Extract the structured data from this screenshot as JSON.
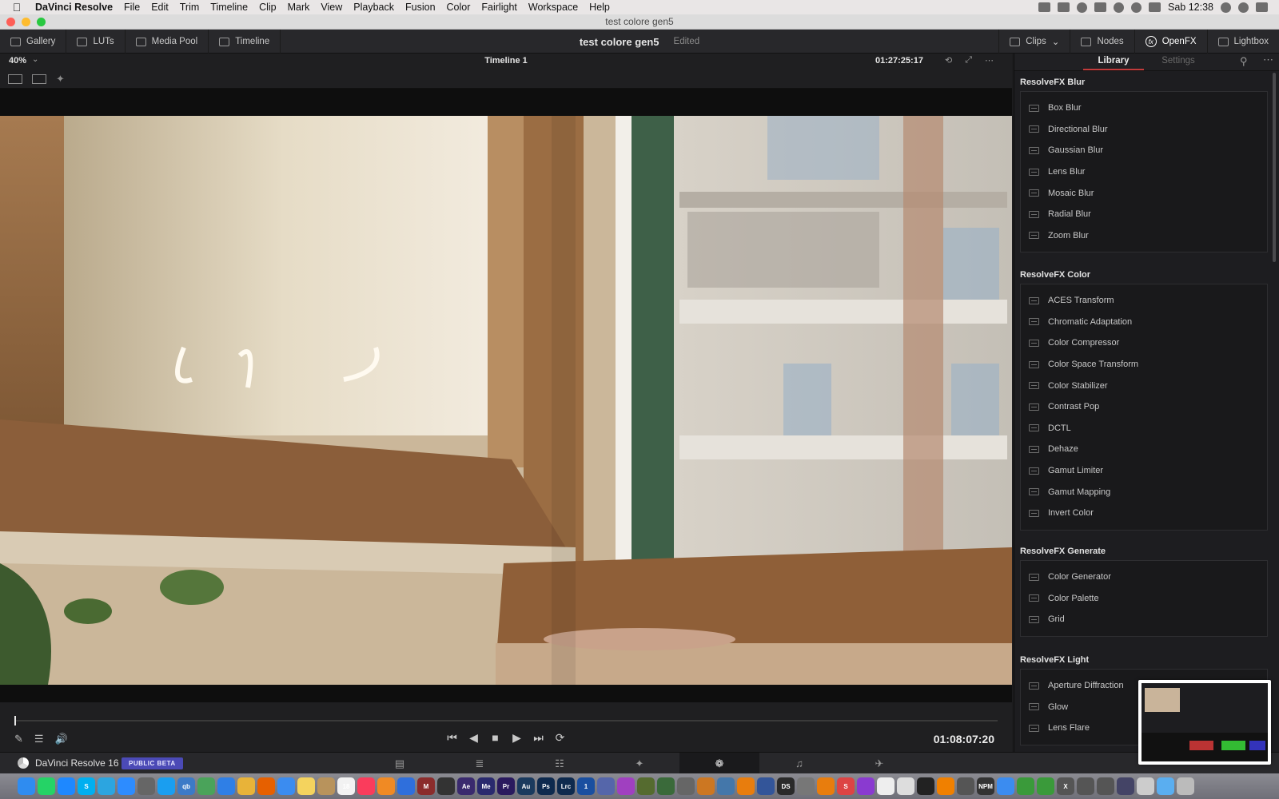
{
  "menubar": {
    "apple_icon": "apple-logo-icon",
    "app_name": "DaVinci Resolve",
    "items": [
      "File",
      "Edit",
      "Trim",
      "Timeline",
      "Clip",
      "Mark",
      "View",
      "Playback",
      "Fusion",
      "Color",
      "Fairlight",
      "Workspace",
      "Help"
    ],
    "clock": "Sab 12:38"
  },
  "window": {
    "title": "test colore gen5"
  },
  "toolbar": {
    "left_buttons": [
      "Gallery",
      "LUTs",
      "Media Pool",
      "Timeline"
    ],
    "project_name": "test colore gen5",
    "status": "Edited",
    "right_buttons": [
      "Clips",
      "Nodes",
      "OpenFX",
      "Lightbox"
    ],
    "active_button": "OpenFX"
  },
  "viewer": {
    "zoom": "40%",
    "timeline_name": "Timeline 1",
    "timecode_top": "01:27:25:17",
    "timecode_bottom": "01:08:07:20"
  },
  "panel": {
    "tabs": {
      "library": "Library",
      "settings": "Settings"
    },
    "active_tab": "Library",
    "accent_color": "#c23b3b",
    "categories": [
      {
        "title": "ResolveFX Blur",
        "items": [
          "Box Blur",
          "Directional Blur",
          "Gaussian Blur",
          "Lens Blur",
          "Mosaic Blur",
          "Radial Blur",
          "Zoom Blur"
        ]
      },
      {
        "title": "ResolveFX Color",
        "items": [
          "ACES Transform",
          "Chromatic Adaptation",
          "Color Compressor",
          "Color Space Transform",
          "Color Stabilizer",
          "Contrast Pop",
          "DCTL",
          "Dehaze",
          "Gamut Limiter",
          "Gamut Mapping",
          "Invert Color"
        ]
      },
      {
        "title": "ResolveFX Generate",
        "items": [
          "Color Generator",
          "Color Palette",
          "Grid"
        ]
      },
      {
        "title": "ResolveFX Light",
        "items": [
          "Aperture Diffraction",
          "Glow",
          "Lens Flare"
        ]
      }
    ]
  },
  "pagebar": {
    "app_label": "DaVinci Resolve 16",
    "badge": "PUBLIC BETA",
    "badge_color": "#4b4ab6",
    "pages": [
      "media-page-icon",
      "cut-page-icon",
      "edit-page-icon",
      "fusion-page-icon",
      "color-page-icon",
      "fairlight-page-icon",
      "deliver-page-icon"
    ],
    "active_page": "color-page-icon"
  },
  "dock": {
    "apps": [
      {
        "name": "finder-icon",
        "label": "",
        "color": "#2f8cf0"
      },
      {
        "name": "whatsapp-icon",
        "label": "",
        "color": "#25d366"
      },
      {
        "name": "messenger-icon",
        "label": "",
        "color": "#1e88ff"
      },
      {
        "name": "skype-icon",
        "label": "S",
        "color": "#00aff0"
      },
      {
        "name": "telegram-icon",
        "label": "",
        "color": "#2ca5e0"
      },
      {
        "name": "zoom-icon",
        "label": "",
        "color": "#2d8cff"
      },
      {
        "name": "calculator-icon",
        "label": "",
        "color": "#666666"
      },
      {
        "name": "safari-icon",
        "label": "",
        "color": "#1a9ef0"
      },
      {
        "name": "qbittorrent-icon",
        "label": "qb",
        "color": "#3c7ac7"
      },
      {
        "name": "maps-icon",
        "label": "",
        "color": "#4aa35a"
      },
      {
        "name": "compass-icon",
        "label": "",
        "color": "#2f7fe6"
      },
      {
        "name": "chrome-icon",
        "label": "",
        "color": "#e8b339"
      },
      {
        "name": "firefox-icon",
        "label": "",
        "color": "#e66000"
      },
      {
        "name": "mail-icon",
        "label": "",
        "color": "#3b8cf0"
      },
      {
        "name": "notes-icon",
        "label": "",
        "color": "#f4d35e"
      },
      {
        "name": "contacts-icon",
        "label": "",
        "color": "#b8935c"
      },
      {
        "name": "calendar-icon",
        "label": "18",
        "color": "#f2f2f2"
      },
      {
        "name": "music-icon",
        "label": "",
        "color": "#fa3c5c"
      },
      {
        "name": "books-icon",
        "label": "",
        "color": "#f08a24"
      },
      {
        "name": "browser-icon",
        "label": "",
        "color": "#2f6fdc"
      },
      {
        "name": "m-app-icon",
        "label": "M",
        "color": "#8b2c2c"
      },
      {
        "name": "resolve-icon",
        "label": "",
        "color": "#333333"
      },
      {
        "name": "after-effects-icon",
        "label": "Ae",
        "color": "#3a2a6e"
      },
      {
        "name": "media-encoder-icon",
        "label": "Me",
        "color": "#2a2a6e"
      },
      {
        "name": "premiere-icon",
        "label": "Pr",
        "color": "#2a1a5e"
      },
      {
        "name": "audition-icon",
        "label": "Au",
        "color": "#1a3a5e"
      },
      {
        "name": "photoshop-icon",
        "label": "Ps",
        "color": "#0e2a4e"
      },
      {
        "name": "lightroom-icon",
        "label": "Lrc",
        "color": "#0e2a4e"
      },
      {
        "name": "1password-icon",
        "label": "1",
        "color": "#1a4fa0"
      },
      {
        "name": "globe-icon",
        "label": "",
        "color": "#5566aa"
      },
      {
        "name": "affinity-icon",
        "label": "",
        "color": "#a040c0"
      },
      {
        "name": "blender-icon",
        "label": "",
        "color": "#556b2f"
      },
      {
        "name": "mountain-icon",
        "label": "",
        "color": "#3a6a3a"
      },
      {
        "name": "zbrush-icon",
        "label": "",
        "color": "#666666"
      },
      {
        "name": "dot-icon",
        "label": "",
        "color": "#cc7722"
      },
      {
        "name": "gear-app-icon",
        "label": "",
        "color": "#4477aa"
      },
      {
        "name": "blender-2-icon",
        "label": "",
        "color": "#e87d0d"
      },
      {
        "name": "sphere-icon",
        "label": "",
        "color": "#335599"
      },
      {
        "name": "daz-studio-icon",
        "label": "DS",
        "color": "#2a2a2a"
      },
      {
        "name": "settings-icon",
        "label": "",
        "color": "#777777"
      },
      {
        "name": "blender-3-icon",
        "label": "",
        "color": "#e87d0d"
      },
      {
        "name": "s-app-icon",
        "label": "S",
        "color": "#d44"
      },
      {
        "name": "podcast-icon",
        "label": "",
        "color": "#8a3ad0"
      },
      {
        "name": "document-icon",
        "label": "",
        "color": "#eeeeee"
      },
      {
        "name": "paper-icon",
        "label": "",
        "color": "#dddddd"
      },
      {
        "name": "terminal-icon",
        "label": "",
        "color": "#222222"
      },
      {
        "name": "vlc-icon",
        "label": "",
        "color": "#f08000"
      },
      {
        "name": "speaker-icon",
        "label": "",
        "color": "#555555"
      },
      {
        "name": "npm-icon",
        "label": "NPM",
        "color": "#333333"
      },
      {
        "name": "shield-app-icon",
        "label": "",
        "color": "#3b8cf0"
      },
      {
        "name": "app-store-icon",
        "label": "",
        "color": "#3a9a3a"
      },
      {
        "name": "sync-icon",
        "label": "",
        "color": "#3a9a3a"
      },
      {
        "name": "x-app-icon",
        "label": "X",
        "color": "#555555"
      },
      {
        "name": "clock-icon",
        "label": "",
        "color": "#555555"
      },
      {
        "name": "photos-icon",
        "label": "",
        "color": "#555555"
      },
      {
        "name": "disk-icon",
        "label": "",
        "color": "#444466"
      },
      {
        "name": "preview-icon",
        "label": "",
        "color": "#cccccc"
      },
      {
        "name": "downloads-icon",
        "label": "",
        "color": "#5aaef0"
      },
      {
        "name": "trash-icon",
        "label": "",
        "color": "#bbbbbb"
      }
    ]
  }
}
